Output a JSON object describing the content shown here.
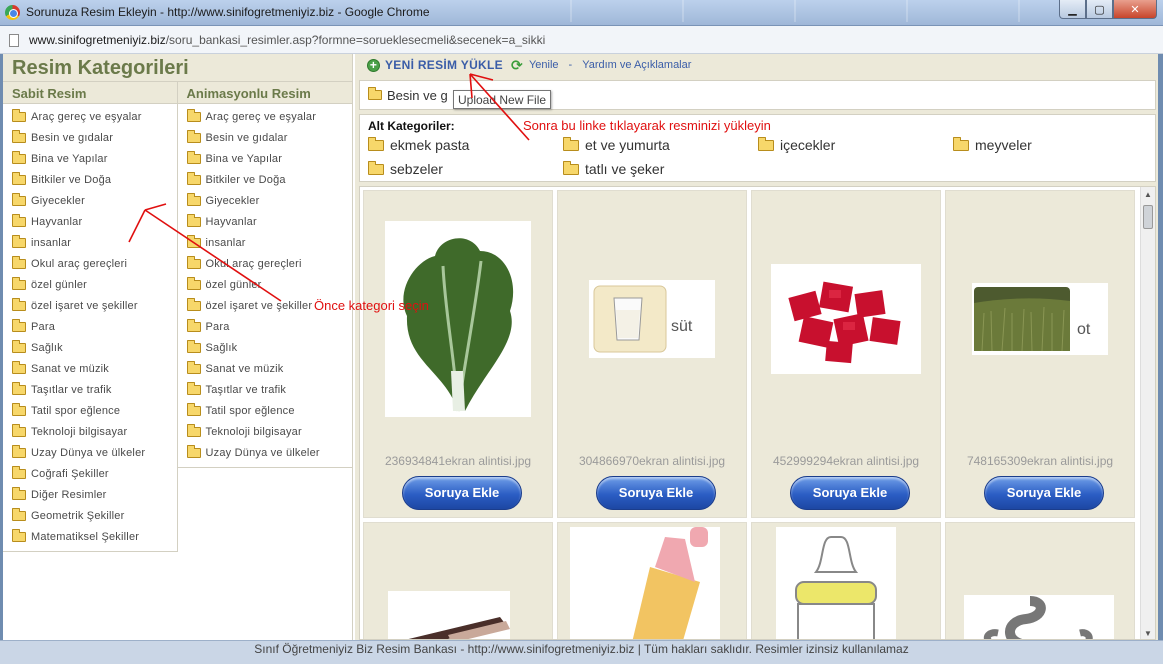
{
  "window": {
    "title": "Sorunuza Resim Ekleyin - http://www.sinifogretmeniyiz.biz - Google Chrome",
    "url_host": "www.sinifogretmeniyiz.biz",
    "url_path": "/soru_bankasi_resimler.asp?formne=sorueklesecmeli&secenek=a_sikki"
  },
  "sidebar": {
    "heading": "Resim Kategorileri",
    "static_col": {
      "heading": "Sabit Resim",
      "items": [
        "Araç gereç ve eşyalar",
        "Besin ve gıdalar",
        "Bina ve Yapılar",
        "Bitkiler ve Doğa",
        "Giyecekler",
        "Hayvanlar",
        "insanlar",
        "Okul araç gereçleri",
        "özel günler",
        "özel işaret ve şekiller",
        "Para",
        "Sağlık",
        "Sanat ve müzik",
        "Taşıtlar ve trafik",
        "Tatil spor eğlence",
        "Teknoloji bilgisayar",
        "Uzay Dünya ve ülkeler",
        "Coğrafi Şekiller",
        "Diğer Resimler",
        "Geometrik Şekiller",
        "Matematiksel Şekiller"
      ]
    },
    "anim_col": {
      "heading": "Animasyonlu Resim",
      "items": [
        "Araç gereç ve eşyalar",
        "Besin ve gıdalar",
        "Bina ve Yapılar",
        "Bitkiler ve Doğa",
        "Giyecekler",
        "Hayvanlar",
        "insanlar",
        "Okul araç gereçleri",
        "özel günler",
        "özel işaret ve şekiller",
        "Para",
        "Sağlık",
        "Sanat ve müzik",
        "Taşıtlar ve trafik",
        "Tatil spor eğlence",
        "Teknoloji bilgisayar",
        "Uzay Dünya ve ülkeler"
      ]
    }
  },
  "toolbar": {
    "upload_label": "YENİ RESİM YÜKLE",
    "refresh_label": "Yenile",
    "separator": "-",
    "help_label": "Yardım ve Açıklamalar"
  },
  "breadcrumb": {
    "text": "Besin ve g"
  },
  "tooltip": {
    "text": "Upload New File"
  },
  "subcategories": {
    "label": "Alt Kategoriler:",
    "items": [
      "ekmek pasta",
      "et ve yumurta",
      "içecekler",
      "meyveler",
      "sebzeler",
      "tatlı ve şeker"
    ]
  },
  "gallery": {
    "button_label": "Soruya Ekle",
    "cards": [
      {
        "filename": "236934841ekran alintisi.jpg",
        "thumb": "lettuce",
        "caption": ""
      },
      {
        "filename": "304866970ekran alintisi.jpg",
        "thumb": "milk",
        "caption": "süt"
      },
      {
        "filename": "452999294ekran alintisi.jpg",
        "thumb": "meat",
        "caption": ""
      },
      {
        "filename": "748165309ekran alintisi.jpg",
        "thumb": "grass",
        "caption": "ot"
      }
    ]
  },
  "annotations": {
    "first": "Önce kategori seçin",
    "second": "Sonra bu linke tıklayarak resminizi yükleyin"
  },
  "status": {
    "text": "Sınıf Öğretmeniyiz Biz Resim Bankası - http://www.sinifogretmeniyiz.biz | Tüm hakları saklıdır. Resimler izinsiz kullanılamaz"
  },
  "colors": {
    "accent": "#3a5da8",
    "panel": "#ece9d9",
    "annotation": "#e01010",
    "heading": "#6b7a4a"
  }
}
